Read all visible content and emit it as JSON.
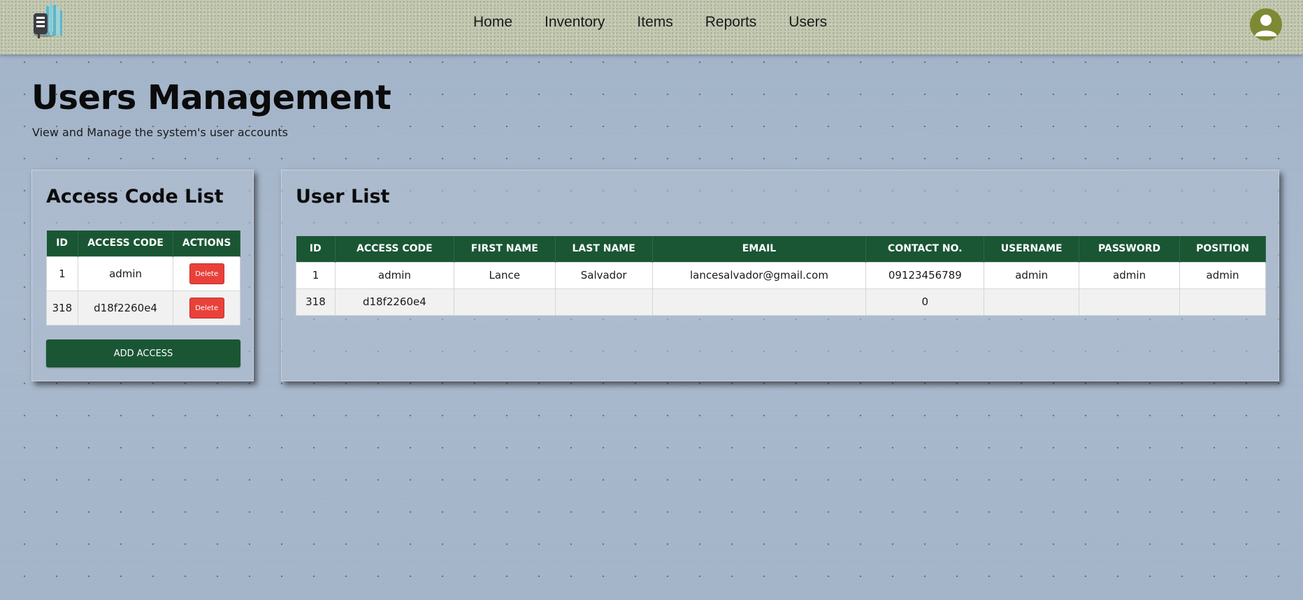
{
  "nav": {
    "links": [
      "Home",
      "Inventory",
      "Items",
      "Reports",
      "Users"
    ]
  },
  "icons": {
    "logo": "document-building-logo-icon",
    "avatar": "user-avatar-icon"
  },
  "colors": {
    "primary_green": "#1a5634",
    "delete_red": "#e8413a",
    "avatar_olive": "#7e8a33"
  },
  "header": {
    "title": "Users Management",
    "subtitle": "View and Manage the system's user accounts"
  },
  "access_codes": {
    "title": "Access Code List",
    "columns": [
      "ID",
      "ACCESS CODE",
      "ACTIONS"
    ],
    "rows": [
      {
        "id": "1",
        "code": "admin",
        "action": "Delete"
      },
      {
        "id": "318",
        "code": "d18f2260e4",
        "action": "Delete"
      }
    ],
    "add_button": "ADD ACCESS"
  },
  "users": {
    "title": "User List",
    "columns": [
      "ID",
      "ACCESS CODE",
      "FIRST NAME",
      "LAST NAME",
      "EMAIL",
      "CONTACT NO.",
      "USERNAME",
      "PASSWORD",
      "POSITION"
    ],
    "rows": [
      [
        "1",
        "admin",
        "Lance",
        "Salvador",
        "lancesalvador@gmail.com",
        "09123456789",
        "admin",
        "admin",
        "admin"
      ],
      [
        "318",
        "d18f2260e4",
        "",
        "",
        "",
        "0",
        "",
        "",
        ""
      ]
    ]
  }
}
